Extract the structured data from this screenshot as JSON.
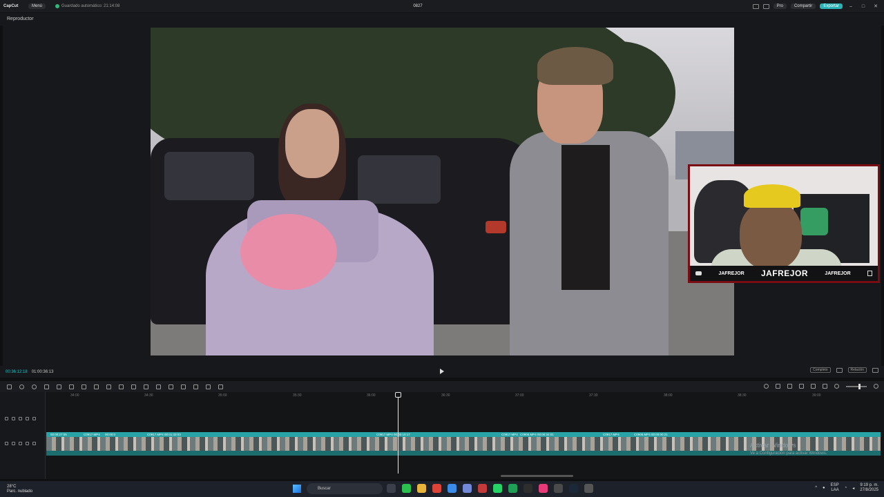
{
  "titlebar": {
    "logo": "CapCut",
    "menu_label": "Menú",
    "autosave": "Guardado automático: 21:14:08",
    "project_title": "0827",
    "pro_label": "Pro",
    "share_label": "Compartir",
    "export_label": "Exportar"
  },
  "player": {
    "header_label": "Reproductor",
    "current_time": "00:36:12:18",
    "duration": "01:00:36:13",
    "full_label": "Completo",
    "ratio_label": "Relación"
  },
  "overlay": {
    "channel_left": "JAFREJOR",
    "channel_center": "JAFREJOR",
    "channel_right": "JAFREJOR"
  },
  "timeline": {
    "ruler": [
      "34:00",
      "34:30",
      "35:00",
      "35:30",
      "36:00",
      "36:30",
      "37:00",
      "37:30",
      "38:00",
      "38:30",
      "39:00"
    ],
    "clips": [
      {
        "label": "00:00:27:05"
      },
      {
        "label": "C0917.MP4"
      },
      {
        "label": "00:00:0"
      },
      {
        "label": "C0917.MP4  00:01:33:03"
      },
      {
        "label": "C0917.MP4  00:00:10:17"
      },
      {
        "label": "C0917.MP4"
      },
      {
        "label": "C0906.MP4  00:00:34:01"
      },
      {
        "label": "C0917.MP4"
      },
      {
        "label": "C0906.MP4  00:00:00:21"
      }
    ]
  },
  "watermark": {
    "line1": "Activar Windows",
    "line2": "Ve a Configuración para activar Windows."
  },
  "taskbar": {
    "temp": "28°C",
    "weather": "Parc. nublado",
    "search_placeholder": "Buscar",
    "lang": "ESP",
    "region": "LAA",
    "time": "9:19 p. m.",
    "date": "27/8/2025"
  },
  "colors": {
    "accent": "#2bb2b6",
    "clip": "#1f7f80",
    "overlay_border": "#7a0c14"
  }
}
